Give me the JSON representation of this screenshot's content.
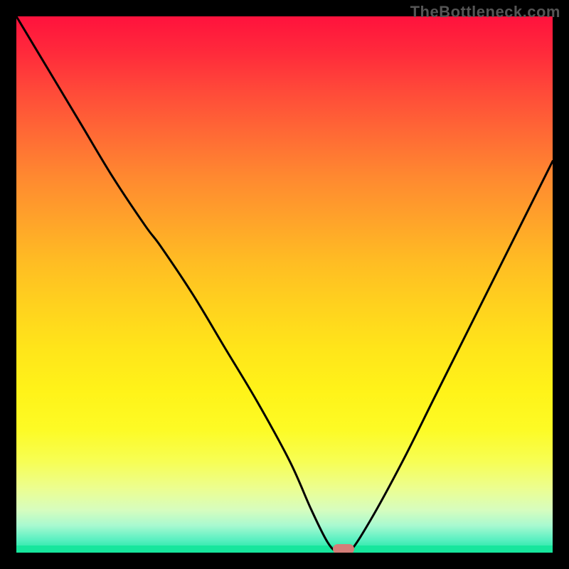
{
  "watermark": "TheBottleneck.com",
  "colors": {
    "frame": "#000000",
    "curve": "#000000",
    "marker": "#d47d78",
    "watermark": "#555555"
  },
  "chart_data": {
    "type": "line",
    "title": "",
    "xlabel": "",
    "ylabel": "",
    "xlim": [
      0,
      100
    ],
    "ylim": [
      0,
      100
    ],
    "grid": false,
    "legend": false,
    "annotations": [
      "TheBottleneck.com"
    ],
    "series": [
      {
        "name": "bottleneck-curve",
        "x": [
          0,
          6,
          12,
          18,
          24,
          27,
          33,
          39,
          45,
          51,
          55,
          58,
          60,
          62,
          66,
          72,
          78,
          84,
          90,
          100
        ],
        "values": [
          100,
          90,
          80,
          70,
          61,
          57,
          48,
          38,
          28,
          17,
          8,
          2,
          0,
          0,
          6,
          17,
          29,
          41,
          53,
          73
        ]
      }
    ],
    "marker": {
      "x": 61,
      "y": 0
    },
    "background_gradient": {
      "direction": "vertical",
      "stops": [
        {
          "pos": 0,
          "color": "#ff123d"
        },
        {
          "pos": 0.5,
          "color": "#ffd21e"
        },
        {
          "pos": 0.85,
          "color": "#f7fe54"
        },
        {
          "pos": 1.0,
          "color": "#17e69d"
        }
      ]
    }
  }
}
